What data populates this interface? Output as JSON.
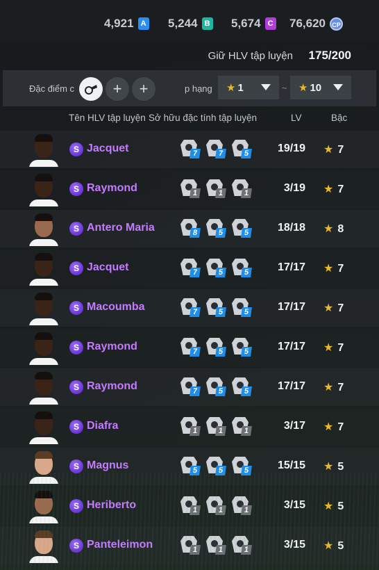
{
  "currencies": [
    {
      "value": "4,921",
      "badge": "A"
    },
    {
      "value": "5,244",
      "badge": "B"
    },
    {
      "value": "5,674",
      "badge": "C"
    },
    {
      "value": "76,620",
      "badge": "CP"
    }
  ],
  "coach_count": {
    "label": "Giữ HLV tập luyện",
    "value": "175/200"
  },
  "filter": {
    "trait_label": "Đặc điểm c",
    "add_symbol": "+",
    "rank_label": "p hạng",
    "rank_from": "1",
    "rank_to": "10",
    "separator": "~",
    "star": "★"
  },
  "columns": {
    "name": "Tên HLV tập luyện",
    "traits": "Sở hữu đặc tính tập luyện",
    "lv": "LV",
    "rank": "Bậc"
  },
  "coaches": [
    {
      "badge": "S",
      "name": "Jacquet",
      "traits": [
        "7",
        "7",
        "5"
      ],
      "trait_colors": [
        "blue",
        "blue",
        "blue"
      ],
      "lv": "19/19",
      "rank": "7",
      "skin": "dark"
    },
    {
      "badge": "S",
      "name": "Raymond",
      "traits": [
        "1",
        "1",
        "1"
      ],
      "trait_colors": [
        "gray",
        "gray",
        "gray"
      ],
      "lv": "3/19",
      "rank": "7",
      "skin": "dark"
    },
    {
      "badge": "S",
      "name": "Antero Maria",
      "traits": [
        "8",
        "5",
        "5"
      ],
      "trait_colors": [
        "blue",
        "blue",
        "blue"
      ],
      "lv": "18/18",
      "rank": "8",
      "skin": "tan"
    },
    {
      "badge": "S",
      "name": "Jacquet",
      "traits": [
        "7",
        "5",
        "5"
      ],
      "trait_colors": [
        "blue",
        "blue",
        "blue"
      ],
      "lv": "17/17",
      "rank": "7",
      "skin": "dark"
    },
    {
      "badge": "S",
      "name": "Macoumba",
      "traits": [
        "7",
        "5",
        "5"
      ],
      "trait_colors": [
        "blue",
        "blue",
        "blue"
      ],
      "lv": "17/17",
      "rank": "7",
      "skin": "dark"
    },
    {
      "badge": "S",
      "name": "Raymond",
      "traits": [
        "7",
        "5",
        "5"
      ],
      "trait_colors": [
        "blue",
        "blue",
        "blue"
      ],
      "lv": "17/17",
      "rank": "7",
      "skin": "dark"
    },
    {
      "badge": "S",
      "name": "Raymond",
      "traits": [
        "7",
        "5",
        "5"
      ],
      "trait_colors": [
        "blue",
        "blue",
        "blue"
      ],
      "lv": "17/17",
      "rank": "7",
      "skin": "dark"
    },
    {
      "badge": "S",
      "name": "Diafra",
      "traits": [
        "1",
        "1",
        "1"
      ],
      "trait_colors": [
        "gray",
        "gray",
        "gray"
      ],
      "lv": "3/17",
      "rank": "7",
      "skin": "dark"
    },
    {
      "badge": "S",
      "name": "Magnus",
      "traits": [
        "5",
        "5",
        "5"
      ],
      "trait_colors": [
        "blue",
        "blue",
        "blue"
      ],
      "lv": "15/15",
      "rank": "5",
      "skin": "light"
    },
    {
      "badge": "S",
      "name": "Heriberto",
      "traits": [
        "1",
        "1",
        "1"
      ],
      "trait_colors": [
        "gray",
        "gray",
        "gray"
      ],
      "lv": "3/15",
      "rank": "5",
      "skin": "tan"
    },
    {
      "badge": "S",
      "name": "Panteleimon",
      "traits": [
        "1",
        "1",
        "1"
      ],
      "trait_colors": [
        "gray",
        "gray",
        "gray"
      ],
      "lv": "3/15",
      "rank": "5",
      "skin": "light"
    }
  ]
}
